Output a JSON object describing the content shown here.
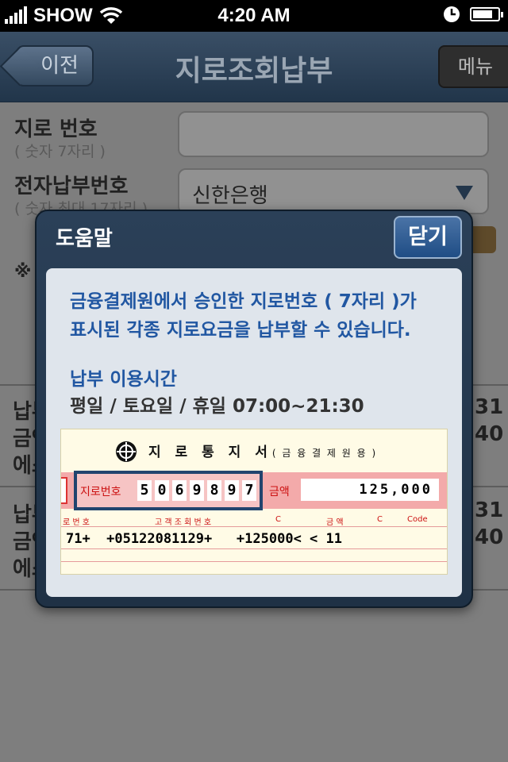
{
  "status_bar": {
    "carrier": "SHOW",
    "time": "4:20 AM"
  },
  "nav": {
    "back_label": "이전",
    "title": "지로조회납부",
    "menu_label": "메뉴"
  },
  "form": {
    "giro_number_label": "지로 번호",
    "giro_number_hint": "( 숫자 7자리 )",
    "epay_label": "전자납부번호",
    "epay_hint": "( 숫자 최대 17자리 )",
    "bank_select_value": "신한은행",
    "note_mark": "※"
  },
  "background_rows": [
    {
      "line1": "납부",
      "line2": "금액",
      "line3": "에스",
      "right1": "31",
      "right2": "40"
    },
    {
      "line1": "납부",
      "line2": "금액",
      "line3": "에스",
      "right1": "31",
      "right2": "40"
    }
  ],
  "dialog": {
    "title": "도움말",
    "close_label": "닫기",
    "desc_line1": "금융결제원에서 승인한 지로번호 ( 7자리 )가",
    "desc_line2": "표시된 각종 지로요금을 납부할 수 있습니다.",
    "hours_title": "납부 이용시간",
    "hours_text": "평일 / 토요일 / 휴일 07:00~21:30"
  },
  "slip": {
    "title": "지 로 통 지 서",
    "title_sub": "( 금 융 결 제 원 용 )",
    "giro_label": "지로번호",
    "giro_digits": [
      "5",
      "0",
      "6",
      "9",
      "8",
      "9",
      "7"
    ],
    "amount_label": "금액",
    "amount_value": "125,000",
    "col_giro": "로 번 호",
    "col_customer": "고 객 조 회 번 호",
    "col_c1": "C",
    "col_amount": "금          액",
    "col_c2": "C",
    "col_code": "Code",
    "ocr_line": "71+  +05122081129+   +125000< < 11"
  }
}
